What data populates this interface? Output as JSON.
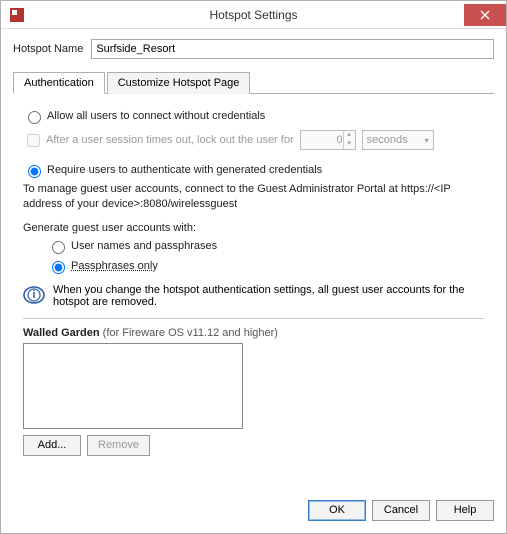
{
  "window": {
    "title": "Hotspot Settings"
  },
  "name": {
    "label": "Hotspot Name",
    "value": "Surfside_Resort"
  },
  "tabs": {
    "auth": "Authentication",
    "custom": "Customize Hotspot Page"
  },
  "auth": {
    "allow_all": "Allow all users to connect without credentials",
    "lockout": "After a user session times out, lock out the user for",
    "lockout_val": "0",
    "lockout_unit": "seconds",
    "require": "Require users to authenticate with generated credentials",
    "manage_desc": "To manage guest user accounts, connect to the Guest Administrator Portal at https://<IP address of your device>:8080/wirelessguest",
    "gen_label": "Generate guest user accounts with:",
    "opt_user": "User names and passphrases",
    "opt_pass": "Passphrases only",
    "info": "When you change the hotspot authentication settings, all guest user accounts for the hotspot are removed."
  },
  "garden": {
    "title": "Walled Garden",
    "sub": "(for Fireware OS v11.12 and higher)",
    "add": "Add...",
    "remove": "Remove"
  },
  "footer": {
    "ok": "OK",
    "cancel": "Cancel",
    "help": "Help"
  }
}
